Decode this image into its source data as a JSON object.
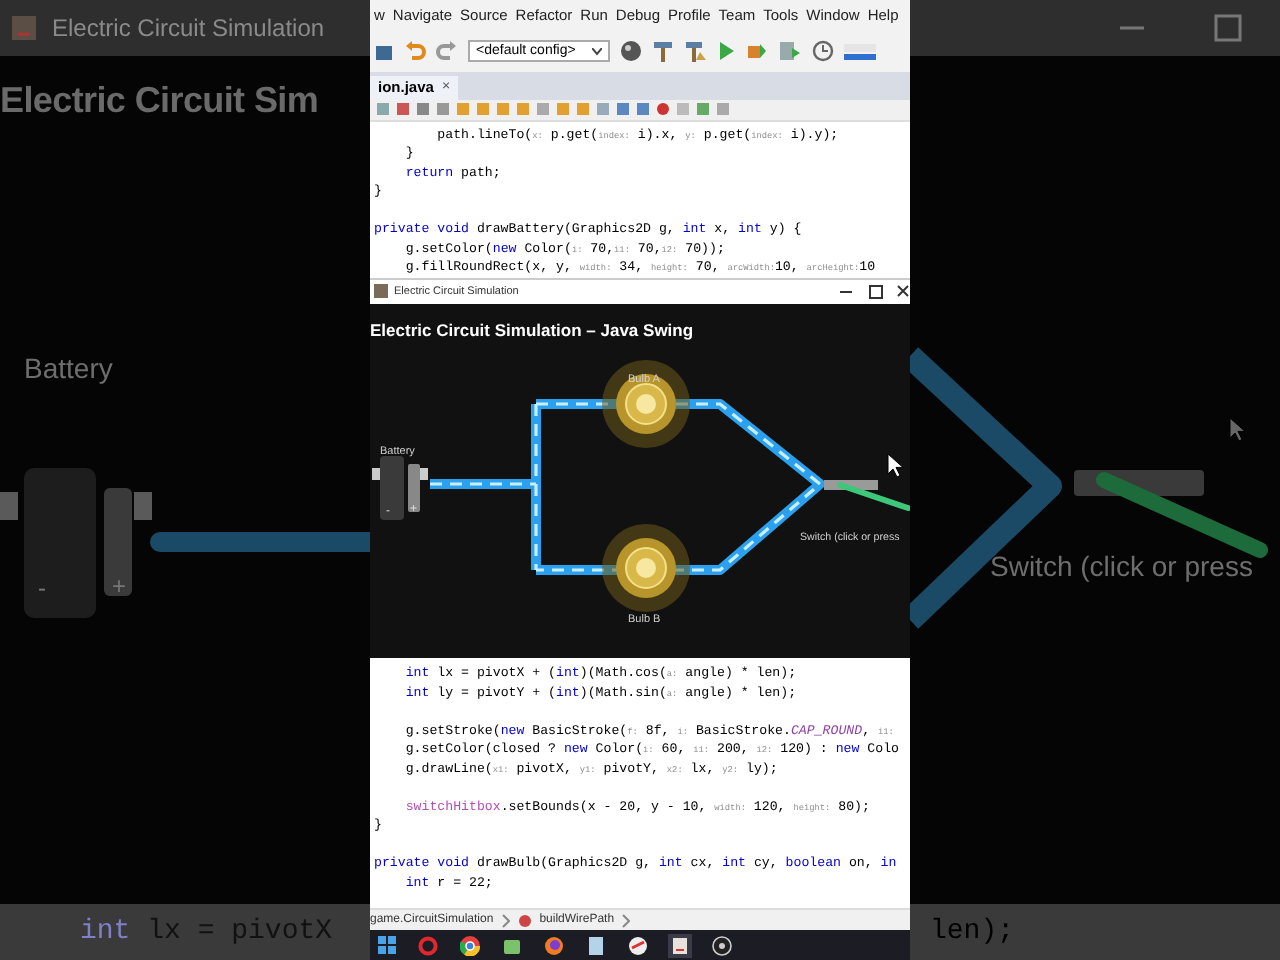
{
  "backdrop": {
    "window_title": "Electric Circuit Simulation",
    "heading": "Electric Circuit Sim",
    "battery_label": "Battery",
    "minus": "-",
    "plus": "+",
    "switch_label": "Switch (click or press",
    "code_left": [
      {
        "kind": "kw",
        "text": "int"
      },
      {
        "kind": "plain",
        "text": " lx = pivotX"
      }
    ],
    "code_right": [
      {
        "kind": "plain",
        "text": "len);"
      }
    ]
  },
  "ide": {
    "menu": [
      "w",
      "Navigate",
      "Source",
      "Refactor",
      "Run",
      "Debug",
      "Profile",
      "Team",
      "Tools",
      "Window",
      "Help"
    ],
    "config": "<default config>",
    "tab": {
      "label": "ion.java",
      "close": "×",
      "selected": true
    },
    "code_top": [
      {
        "tokens": [
          {
            "kind": "plain",
            "text": "        path.lineTo("
          },
          {
            "kind": "hint",
            "text": "x:"
          },
          {
            "kind": "plain",
            "text": " p.get("
          },
          {
            "kind": "hint",
            "text": "index:"
          },
          {
            "kind": "plain",
            "text": " i).x, "
          },
          {
            "kind": "hint",
            "text": "y:"
          },
          {
            "kind": "plain",
            "text": " p.get("
          },
          {
            "kind": "hint",
            "text": "index:"
          },
          {
            "kind": "plain",
            "text": " i).y);"
          }
        ]
      },
      {
        "tokens": [
          {
            "kind": "plain",
            "text": "    }"
          }
        ]
      },
      {
        "tokens": [
          {
            "kind": "kw",
            "text": "    return"
          },
          {
            "kind": "plain",
            "text": " path;"
          }
        ]
      },
      {
        "tokens": [
          {
            "kind": "plain",
            "text": "}"
          }
        ]
      },
      {
        "blank_before": true,
        "tokens": [
          {
            "kind": "kw",
            "text": "private void"
          },
          {
            "kind": "plain",
            "text": " drawBattery(Graphics2D g, "
          },
          {
            "kind": "kw",
            "text": "int"
          },
          {
            "kind": "plain",
            "text": " x, "
          },
          {
            "kind": "kw",
            "text": "int"
          },
          {
            "kind": "plain",
            "text": " y) {"
          }
        ]
      },
      {
        "tokens": [
          {
            "kind": "plain",
            "text": "    g.setColor("
          },
          {
            "kind": "kw",
            "text": "new"
          },
          {
            "kind": "plain",
            "text": " Color("
          },
          {
            "kind": "hint",
            "text": "i:"
          },
          {
            "kind": "plain",
            "text": " 70,"
          },
          {
            "kind": "hint",
            "text": "i1:"
          },
          {
            "kind": "plain",
            "text": " 70,"
          },
          {
            "kind": "hint",
            "text": "i2:"
          },
          {
            "kind": "plain",
            "text": " 70));"
          }
        ]
      },
      {
        "tokens": [
          {
            "kind": "plain",
            "text": "    g.fillRoundRect(x, y, "
          },
          {
            "kind": "hint",
            "text": "width:"
          },
          {
            "kind": "plain",
            "text": " 34, "
          },
          {
            "kind": "hint",
            "text": "height:"
          },
          {
            "kind": "plain",
            "text": " 70, "
          },
          {
            "kind": "hint",
            "text": "arcWidth:"
          },
          {
            "kind": "plain",
            "text": "10, "
          },
          {
            "kind": "hint",
            "text": "arcHeight:"
          },
          {
            "kind": "plain",
            "text": "10"
          }
        ]
      }
    ],
    "code_bottom": [
      {
        "tokens": [
          {
            "kind": "kw",
            "text": "    int"
          },
          {
            "kind": "plain",
            "text": " lx = pivotX + ("
          },
          {
            "kind": "kw",
            "text": "int"
          },
          {
            "kind": "plain",
            "text": ")(Math.cos("
          },
          {
            "kind": "hint",
            "text": "a:"
          },
          {
            "kind": "plain",
            "text": " angle) * len);"
          }
        ]
      },
      {
        "tokens": [
          {
            "kind": "kw",
            "text": "    int"
          },
          {
            "kind": "plain",
            "text": " ly = pivotY + ("
          },
          {
            "kind": "kw",
            "text": "int"
          },
          {
            "kind": "plain",
            "text": ")(Math.sin("
          },
          {
            "kind": "hint",
            "text": "a:"
          },
          {
            "kind": "plain",
            "text": " angle) * len);"
          }
        ]
      },
      {
        "blank_before": true,
        "tokens": [
          {
            "kind": "plain",
            "text": "    g.setStroke("
          },
          {
            "kind": "kw",
            "text": "new"
          },
          {
            "kind": "plain",
            "text": " BasicStroke("
          },
          {
            "kind": "hint",
            "text": "f:"
          },
          {
            "kind": "plain",
            "text": " 8f, "
          },
          {
            "kind": "hint",
            "text": "i:"
          },
          {
            "kind": "plain",
            "text": " BasicStroke."
          },
          {
            "kind": "const",
            "text": "CAP_ROUND"
          },
          {
            "kind": "plain",
            "text": ", "
          },
          {
            "kind": "hint",
            "text": "i1:"
          }
        ]
      },
      {
        "tokens": [
          {
            "kind": "plain",
            "text": "    g.setColor(closed ? "
          },
          {
            "kind": "kw",
            "text": "new"
          },
          {
            "kind": "plain",
            "text": " Color("
          },
          {
            "kind": "hint",
            "text": "i:"
          },
          {
            "kind": "plain",
            "text": " 60, "
          },
          {
            "kind": "hint",
            "text": "i1:"
          },
          {
            "kind": "plain",
            "text": " 200, "
          },
          {
            "kind": "hint",
            "text": "i2:"
          },
          {
            "kind": "plain",
            "text": " 120) : "
          },
          {
            "kind": "kw",
            "text": "new"
          },
          {
            "kind": "plain",
            "text": " Colo"
          }
        ]
      },
      {
        "tokens": [
          {
            "kind": "plain",
            "text": "    g.drawLine("
          },
          {
            "kind": "hint",
            "text": "x1:"
          },
          {
            "kind": "plain",
            "text": " pivotX, "
          },
          {
            "kind": "hint",
            "text": "y1:"
          },
          {
            "kind": "plain",
            "text": " pivotY, "
          },
          {
            "kind": "hint",
            "text": "x2:"
          },
          {
            "kind": "plain",
            "text": " lx, "
          },
          {
            "kind": "hint",
            "text": "y2:"
          },
          {
            "kind": "plain",
            "text": " ly);"
          }
        ]
      },
      {
        "blank_before": true,
        "tokens": [
          {
            "kind": "field",
            "text": "    switchHitbox"
          },
          {
            "kind": "plain",
            "text": ".setBounds(x - 20, y - 10, "
          },
          {
            "kind": "hint",
            "text": "width:"
          },
          {
            "kind": "plain",
            "text": " 120, "
          },
          {
            "kind": "hint",
            "text": "height:"
          },
          {
            "kind": "plain",
            "text": " 80);"
          }
        ]
      },
      {
        "tokens": [
          {
            "kind": "plain",
            "text": "}"
          }
        ]
      },
      {
        "blank_before": true,
        "tokens": [
          {
            "kind": "kw",
            "text": "private void"
          },
          {
            "kind": "plain",
            "text": " drawBulb(Graphics2D g, "
          },
          {
            "kind": "kw",
            "text": "int"
          },
          {
            "kind": "plain",
            "text": " cx, "
          },
          {
            "kind": "kw",
            "text": "int"
          },
          {
            "kind": "plain",
            "text": " cy, "
          },
          {
            "kind": "kw",
            "text": "boolean"
          },
          {
            "kind": "plain",
            "text": " on, "
          },
          {
            "kind": "kw",
            "text": "in"
          }
        ]
      },
      {
        "tokens": [
          {
            "kind": "kw",
            "text": "    int"
          },
          {
            "kind": "plain",
            "text": " r = 22;"
          }
        ]
      }
    ],
    "breadcrumbs": [
      "game.CircuitSimulation",
      "buildWirePath"
    ]
  },
  "sim": {
    "window_title": "Electric Circuit Simulation",
    "heading": "Electric Circuit Simulation – Java Swing",
    "battery_label": "Battery",
    "minus": "-",
    "plus": "+",
    "bulbs": [
      {
        "label": "Bulb A",
        "on": true
      },
      {
        "label": "Bulb B",
        "on": true
      }
    ],
    "switch": {
      "label": "Switch (click or press",
      "closed": true
    }
  }
}
